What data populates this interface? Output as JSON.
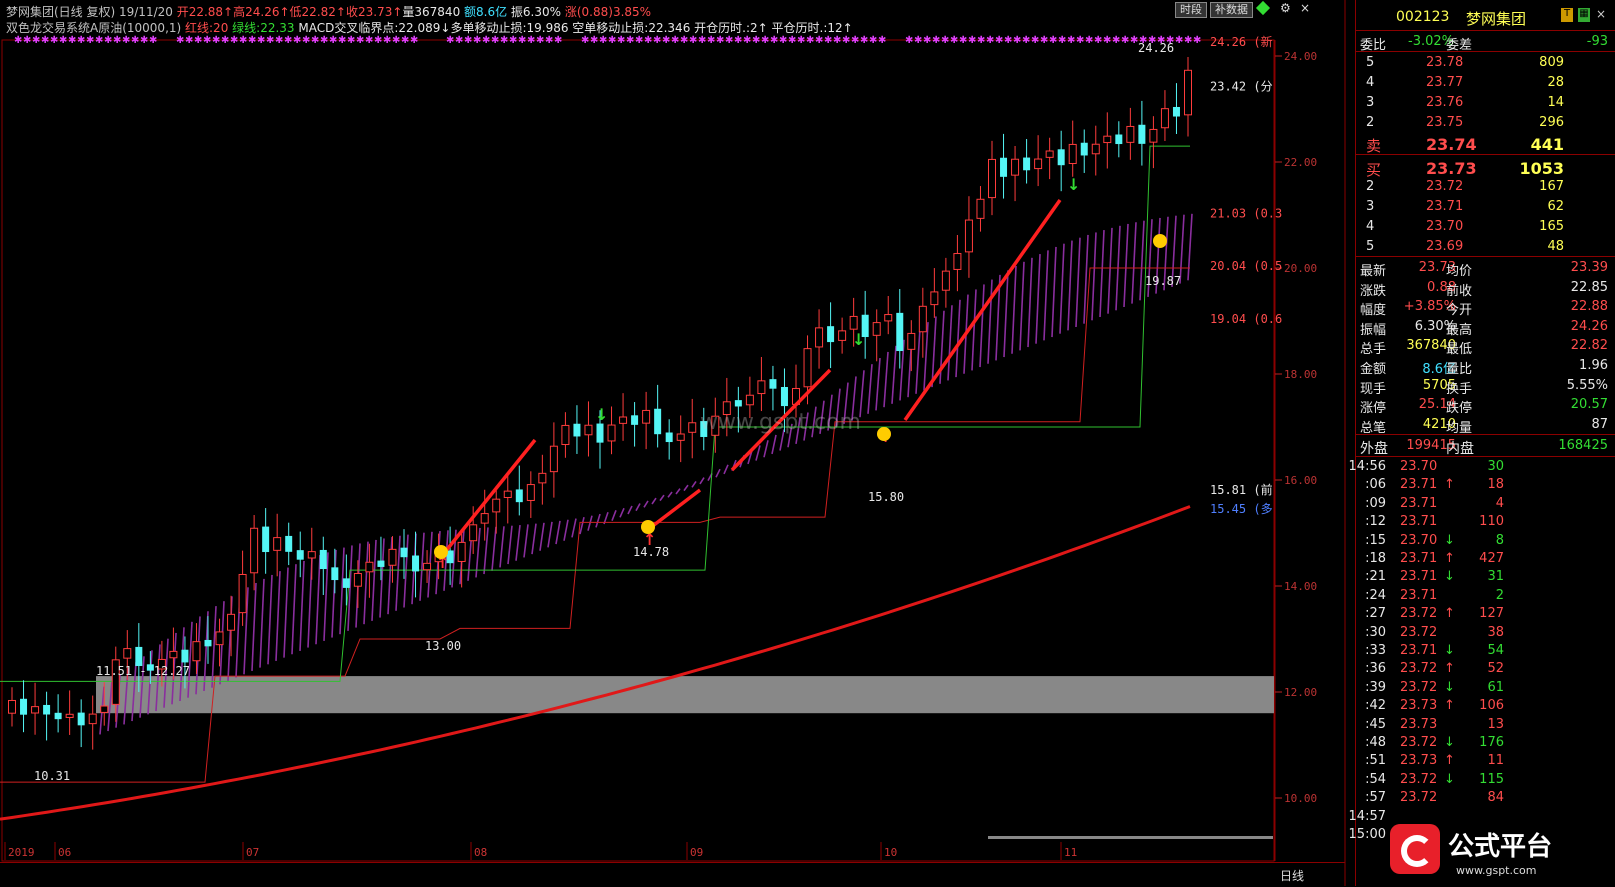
{
  "header": {
    "line1": [
      {
        "text": "梦网集团(日线 复权) 19/11/20",
        "color": "#c0c0c0"
      },
      {
        "text": " 开22.88↑",
        "color": "#ff4d4d"
      },
      {
        "text": "高24.26↑",
        "color": "#ff4d4d"
      },
      {
        "text": "低22.82↑",
        "color": "#ff4d4d"
      },
      {
        "text": "收23.73↑",
        "color": "#ff4d4d"
      },
      {
        "text": "量367840",
        "color": "#e8e8e8"
      },
      {
        "text": " 额8.6亿",
        "color": "#40e0ff"
      },
      {
        "text": " 振6.30%",
        "color": "#e8e8e8"
      },
      {
        "text": " 涨(0.88)3.85%",
        "color": "#ff4d4d"
      }
    ],
    "line2": [
      {
        "text": "双色龙交易系统A原油(10000,1)",
        "color": "#c0c0c0"
      },
      {
        "text": " 红线:20",
        "color": "#ff4d4d"
      },
      {
        "text": " 绿线:22.33",
        "color": "#33dd33"
      },
      {
        "text": " MACD交叉临界点:22.089↓",
        "color": "#e8e8e8"
      },
      {
        "text": "多单移动止损:19.986",
        "color": "#e8e8e8"
      },
      {
        "text": " 空单移动止损:22.346",
        "color": "#e8e8e8"
      },
      {
        "text": " 开仓历时.:2↑",
        "color": "#e8e8e8"
      },
      {
        "text": " 平仓历时.:12↑",
        "color": "#e8e8e8"
      }
    ],
    "buttons": {
      "timeshare": "时段",
      "supplement": "补数据"
    }
  },
  "watermark": "www.gspt.com",
  "chart_data": {
    "type": "candlestick",
    "price_axis": {
      "min": 10.0,
      "max": 24.0,
      "ticks": [
        "24.00",
        "22.00",
        "20.00",
        "18.00",
        "16.00",
        "14.00",
        "12.00",
        "10.00"
      ]
    },
    "time_axis": {
      "labels": [
        "2019",
        "06",
        "07",
        "08",
        "09",
        "10",
        "11"
      ]
    },
    "right_labels": [
      {
        "text": "24.26 (新",
        "price": 24.26,
        "color": "#ff4d4d"
      },
      {
        "text": "23.42 (分",
        "price": 23.42,
        "color": "#e8e8e8"
      },
      {
        "text": "21.03 (0.3",
        "price": 21.03,
        "color": "#ff4d4d"
      },
      {
        "text": "20.04 (0.5",
        "price": 20.04,
        "color": "#ff4d4d"
      },
      {
        "text": "19.04 (0.6",
        "price": 19.04,
        "color": "#ff4d4d"
      },
      {
        "text": "15.81 (前",
        "price": 15.81,
        "color": "#e8e8e8"
      },
      {
        "text": "15.45 (多",
        "price": 15.45,
        "color": "#4f7fff"
      }
    ],
    "annotations": [
      "24.26",
      "19.87",
      "15.80",
      "14.78",
      "13.00",
      "11.51 - 12.27",
      "10.31"
    ],
    "grey_band": {
      "low": 11.6,
      "high": 12.3
    },
    "ma_line": {
      "start": 9.6,
      "end": 15.5
    },
    "stock_name_line1_sample": "梦网集团",
    "bottom_tab": "日线"
  },
  "quote_panel": {
    "code": "002123",
    "name": "梦网集团",
    "webi": {
      "label": "委比",
      "value": "-3.02%",
      "label2": "委差",
      "value2": "-93"
    },
    "sell": [
      {
        "level": "5",
        "price": "23.78",
        "vol": "809"
      },
      {
        "level": "4",
        "price": "23.77",
        "vol": "28"
      },
      {
        "level": "3",
        "price": "23.76",
        "vol": "14"
      },
      {
        "level": "2",
        "price": "23.75",
        "vol": "296"
      },
      {
        "level": "卖",
        "price": "23.74",
        "vol": "441"
      }
    ],
    "buy": [
      {
        "level": "买",
        "price": "23.73",
        "vol": "1053"
      },
      {
        "level": "2",
        "price": "23.72",
        "vol": "167"
      },
      {
        "level": "3",
        "price": "23.71",
        "vol": "62"
      },
      {
        "level": "4",
        "price": "23.70",
        "vol": "165"
      },
      {
        "level": "5",
        "price": "23.69",
        "vol": "48"
      }
    ],
    "stats": [
      {
        "l1": "最新",
        "v1": "23.73",
        "c1": "#ff4d4d",
        "l2": "均价",
        "v2": "23.39",
        "c2": "#ff4d4d"
      },
      {
        "l1": "涨跌",
        "v1": "0.88",
        "c1": "#ff4d4d",
        "l2": "前收",
        "v2": "22.85",
        "c2": "#e8e8e8"
      },
      {
        "l1": "幅度",
        "v1": "+3.85%",
        "c1": "#ff4d4d",
        "l2": "今开",
        "v2": "22.88",
        "c2": "#ff4d4d"
      },
      {
        "l1": "振幅",
        "v1": "6.30%",
        "c1": "#e8e8e8",
        "l2": "最高",
        "v2": "24.26",
        "c2": "#ff4d4d"
      },
      {
        "l1": "总手",
        "v1": "367840",
        "c1": "#ffff55",
        "l2": "最低",
        "v2": "22.82",
        "c2": "#ff4d4d"
      },
      {
        "l1": "金额",
        "v1": "8.6亿",
        "c1": "#40e0ff",
        "l2": "量比",
        "v2": "1.96",
        "c2": "#e8e8e8"
      },
      {
        "l1": "现手",
        "v1": "5705",
        "c1": "#ffff55",
        "l2": "换手",
        "v2": "5.55%",
        "c2": "#e8e8e8"
      },
      {
        "l1": "涨停",
        "v1": "25.14",
        "c1": "#ff4d4d",
        "l2": "跌停",
        "v2": "20.57",
        "c2": "#33dd33"
      },
      {
        "l1": "总笔",
        "v1": "4210",
        "c1": "#ffff55",
        "l2": "均量",
        "v2": "87",
        "c2": "#e8e8e8"
      }
    ],
    "outer": {
      "label": "外盘",
      "value": "199415",
      "label2": "内盘",
      "value2": "168425"
    },
    "ticks": [
      {
        "t": "14:56",
        "p": "23.70",
        "d": "",
        "v": "30",
        "vc": "#33dd33"
      },
      {
        "t": ":06",
        "p": "23.71",
        "d": "↑",
        "v": "18",
        "vc": "#ff4d4d"
      },
      {
        "t": ":09",
        "p": "23.71",
        "d": "",
        "v": "4",
        "vc": "#ff4d4d"
      },
      {
        "t": ":12",
        "p": "23.71",
        "d": "",
        "v": "110",
        "vc": "#ff4d4d"
      },
      {
        "t": ":15",
        "p": "23.70",
        "d": "↓",
        "v": "8",
        "vc": "#33dd33"
      },
      {
        "t": ":18",
        "p": "23.71",
        "d": "↑",
        "v": "427",
        "vc": "#ff4d4d"
      },
      {
        "t": ":21",
        "p": "23.71",
        "d": "↓",
        "v": "31",
        "vc": "#33dd33"
      },
      {
        "t": ":24",
        "p": "23.71",
        "d": "",
        "v": "2",
        "vc": "#33dd33"
      },
      {
        "t": ":27",
        "p": "23.72",
        "d": "↑",
        "v": "127",
        "vc": "#ff4d4d"
      },
      {
        "t": ":30",
        "p": "23.72",
        "d": "",
        "v": "38",
        "vc": "#ff4d4d"
      },
      {
        "t": ":33",
        "p": "23.71",
        "d": "↓",
        "v": "54",
        "vc": "#33dd33"
      },
      {
        "t": ":36",
        "p": "23.72",
        "d": "↑",
        "v": "52",
        "vc": "#ff4d4d"
      },
      {
        "t": ":39",
        "p": "23.72",
        "d": "↓",
        "v": "61",
        "vc": "#33dd33"
      },
      {
        "t": ":42",
        "p": "23.73",
        "d": "↑",
        "v": "106",
        "vc": "#ff4d4d"
      },
      {
        "t": ":45",
        "p": "23.73",
        "d": "",
        "v": "13",
        "vc": "#ff4d4d"
      },
      {
        "t": ":48",
        "p": "23.72",
        "d": "↓",
        "v": "176",
        "vc": "#33dd33"
      },
      {
        "t": ":51",
        "p": "23.73",
        "d": "↑",
        "v": "11",
        "vc": "#ff4d4d"
      },
      {
        "t": ":54",
        "p": "23.72",
        "d": "↓",
        "v": "115",
        "vc": "#33dd33"
      },
      {
        "t": ":57",
        "p": "23.72",
        "d": "",
        "v": "84",
        "vc": "#ff4d4d"
      },
      {
        "t": "14:57",
        "p": "",
        "d": "",
        "v": "",
        "vc": "#ff4d4d"
      },
      {
        "t": "15:00",
        "p": "",
        "d": "",
        "v": "",
        "vc": "#ff4d4d"
      }
    ],
    "logo_text": "公式平台",
    "logo_url": "www.gspt.com"
  }
}
